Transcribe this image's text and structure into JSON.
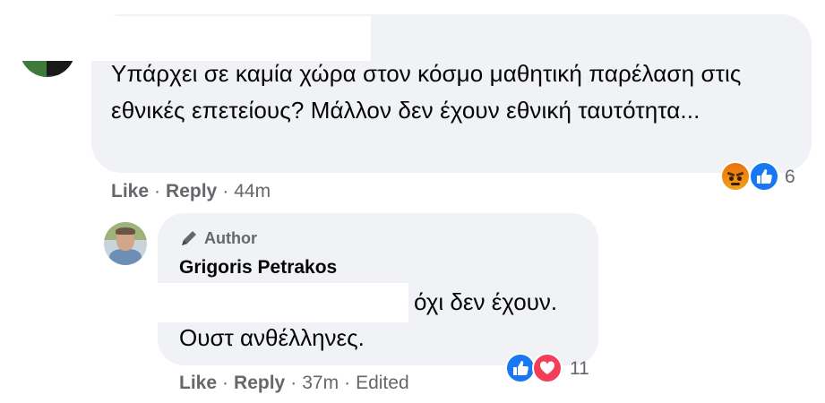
{
  "comment1": {
    "text": "Υπάρχει σε καμία χώρα στον κόσμο μαθητική παρέλαση στις εθνικές επετείους? Μάλλον δεν έχουν εθνική ταυτότητα...",
    "reactions": {
      "icons": [
        "angry-icon",
        "like-icon"
      ],
      "count": "6"
    },
    "actions": {
      "like": "Like",
      "reply": "Reply",
      "time": "44m"
    }
  },
  "reply1": {
    "badge": "Author",
    "author": "Grigoris Petrakos",
    "line1": "όχι δεν έχουν.",
    "line2": "Ουστ ανθέλληνες.",
    "reactions": {
      "icons": [
        "like-icon",
        "love-icon"
      ],
      "count": "11"
    },
    "actions": {
      "like": "Like",
      "reply": "Reply",
      "time": "37m",
      "edited": "Edited"
    }
  },
  "colors": {
    "bubble": "#f0f2f5",
    "secondary_text": "#65676b",
    "like_blue": "#1877f2",
    "love_red": "#f33e58",
    "angry_orange": "#e9710f"
  }
}
